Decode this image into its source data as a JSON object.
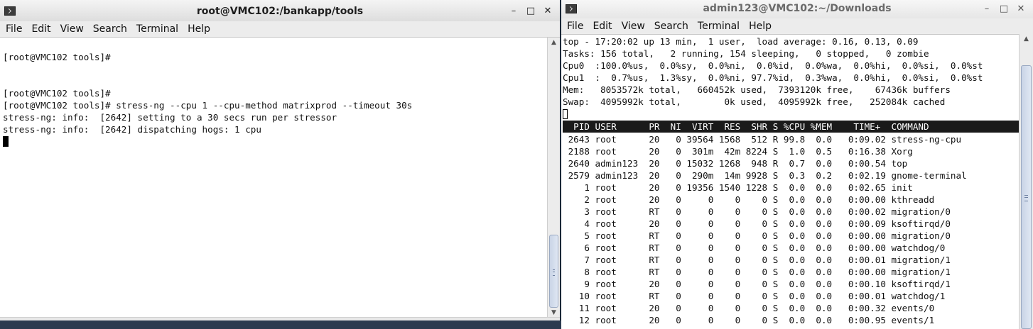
{
  "left_window": {
    "title": "root@VMC102:/bankapp/tools",
    "menu": [
      "File",
      "Edit",
      "View",
      "Search",
      "Terminal",
      "Help"
    ],
    "buttons": {
      "minimize": "–",
      "maximize": "□",
      "close": "✕"
    },
    "lines": [
      "",
      "[root@VMC102 tools]#",
      "",
      "",
      "[root@VMC102 tools]#",
      "[root@VMC102 tools]# stress-ng --cpu 1 --cpu-method matrixprod --timeout 30s",
      "stress-ng: info:  [2642] setting to a 30 secs run per stressor",
      "stress-ng: info:  [2642] dispatching hogs: 1 cpu"
    ]
  },
  "right_window": {
    "title": "admin123@VMC102:~/Downloads",
    "menu": [
      "File",
      "Edit",
      "View",
      "Search",
      "Terminal",
      "Help"
    ],
    "buttons": {
      "minimize": "–",
      "maximize": "□",
      "close": "✕"
    },
    "summary": [
      "top - 17:20:02 up 13 min,  1 user,  load average: 0.16, 0.13, 0.09",
      "Tasks: 156 total,   2 running, 154 sleeping,   0 stopped,   0 zombie",
      "Cpu0  :100.0%us,  0.0%sy,  0.0%ni,  0.0%id,  0.0%wa,  0.0%hi,  0.0%si,  0.0%st",
      "Cpu1  :  0.7%us,  1.3%sy,  0.0%ni, 97.7%id,  0.3%wa,  0.0%hi,  0.0%si,  0.0%st",
      "Mem:   8053572k total,   660452k used,  7393120k free,    67436k buffers",
      "Swap:  4095992k total,        0k used,  4095992k free,   252084k cached"
    ],
    "header": "  PID USER      PR  NI  VIRT  RES  SHR S %CPU %MEM    TIME+  COMMAND",
    "processes": [
      " 2643 root      20   0 39564 1568  512 R 99.8  0.0   0:09.02 stress-ng-cpu",
      " 2188 root      20   0  301m  42m 8224 S  1.0  0.5   0:16.38 Xorg",
      " 2640 admin123  20   0 15032 1268  948 R  0.7  0.0   0:00.54 top",
      " 2579 admin123  20   0  290m  14m 9928 S  0.3  0.2   0:02.19 gnome-terminal",
      "    1 root      20   0 19356 1540 1228 S  0.0  0.0   0:02.65 init",
      "    2 root      20   0     0    0    0 S  0.0  0.0   0:00.00 kthreadd",
      "    3 root      RT   0     0    0    0 S  0.0  0.0   0:00.02 migration/0",
      "    4 root      20   0     0    0    0 S  0.0  0.0   0:00.09 ksoftirqd/0",
      "    5 root      RT   0     0    0    0 S  0.0  0.0   0:00.00 migration/0",
      "    6 root      RT   0     0    0    0 S  0.0  0.0   0:00.00 watchdog/0",
      "    7 root      RT   0     0    0    0 S  0.0  0.0   0:00.01 migration/1",
      "    8 root      RT   0     0    0    0 S  0.0  0.0   0:00.00 migration/1",
      "    9 root      20   0     0    0    0 S  0.0  0.0   0:00.10 ksoftirqd/1",
      "   10 root      RT   0     0    0    0 S  0.0  0.0   0:00.01 watchdog/1",
      "   11 root      20   0     0    0    0 S  0.0  0.0   0:00.32 events/0",
      "   12 root      20   0     0    0    0 S  0.0  0.0   0:00.95 events/1"
    ]
  },
  "icons": {
    "terminal": "terminal-icon",
    "scroll_up": "▲",
    "scroll_down": "▼"
  }
}
